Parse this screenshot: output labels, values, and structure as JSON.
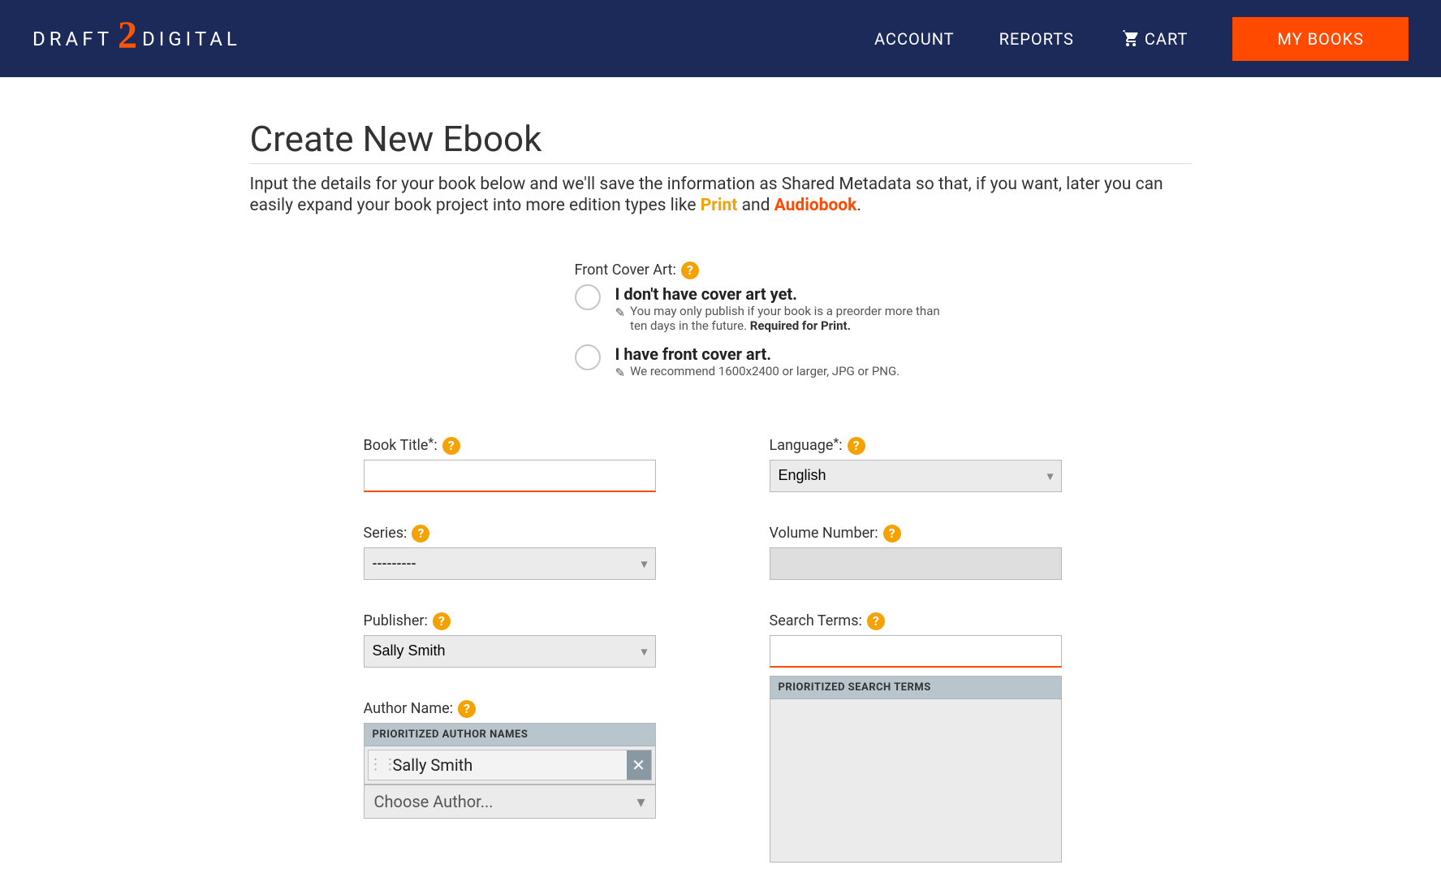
{
  "header": {
    "logo_left": "DRAFT",
    "logo_mid": "2",
    "logo_right": "DIGITAL",
    "nav": {
      "account": "ACCOUNT",
      "reports": "REPORTS",
      "cart": "CART",
      "my_books": "MY BOOKS"
    }
  },
  "page": {
    "title": "Create New Ebook",
    "intro_a": "Input the details for your book below and we'll save the information as Shared Metadata so that, if you want, later you can easily expand your book project into more edition types like ",
    "intro_print": "Print",
    "intro_and": " and ",
    "intro_audio": "Audiobook",
    "intro_end": "."
  },
  "cover": {
    "label": "Front Cover Art:",
    "opt1_title": "I don't have cover art yet.",
    "opt1_sub_a": "You may only publish if your book is a preorder more than ten days in the future. ",
    "opt1_sub_b": "Required for Print.",
    "opt2_title": "I have front cover art.",
    "opt2_sub": "We recommend 1600x2400 or larger, JPG or PNG."
  },
  "form": {
    "book_title_label": "Book Title",
    "language_label": "Language",
    "language_value": "English",
    "series_label": "Series:",
    "series_value": "---------",
    "volume_label": "Volume Number:",
    "publisher_label": "Publisher:",
    "publisher_value": "Sally Smith",
    "search_terms_label": "Search Terms:",
    "author_label": "Author Name:",
    "author_panel_header": "PRIORITIZED AUTHOR NAMES",
    "author_item": "Sally Smith",
    "choose_author": "Choose Author...",
    "terms_panel_header": "PRIORITIZED SEARCH TERMS"
  }
}
